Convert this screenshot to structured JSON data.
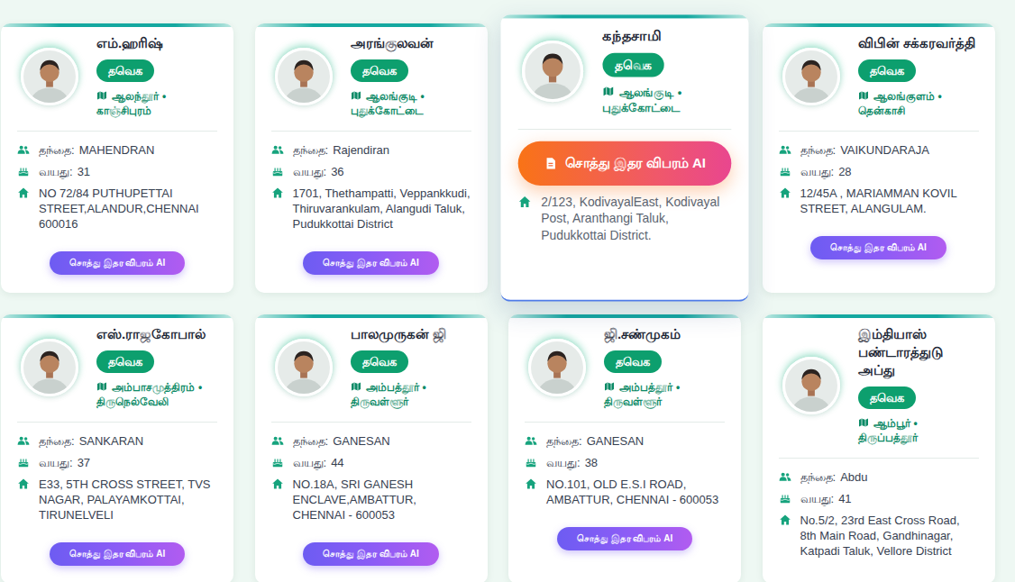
{
  "labels": {
    "father": "தந்தை:",
    "age": "வயது:"
  },
  "separator": "•",
  "button_label": "சொத்து இதர விபரம் AI",
  "candidates": [
    {
      "name": "எம்.ஹரிஷ்",
      "party": "தவெக",
      "constituency": "ஆலந்தூர்",
      "district": "காஞ்சிபுரம்",
      "father": "MAHENDRAN",
      "age": "31",
      "address": "NO 72/84 PUTHUPETTAI STREET,ALANDUR,CHENNAI 600016",
      "hovered": false,
      "button_visible": true
    },
    {
      "name": "அரங்குலவன்",
      "party": "தவெக",
      "constituency": "ஆலங்குடி",
      "district": "புதுக்கோட்டை",
      "father": "Rajendiran",
      "age": "36",
      "address": "1701, Thethampatti, Veppankkudi, Thiruvarankulam, Alangudi Taluk, Pudukkottai District",
      "hovered": false,
      "button_visible": true
    },
    {
      "name": "கந்தசாமி",
      "party": "தவெக",
      "constituency": "ஆலங்குடி",
      "district": "புதுக்கோட்டை",
      "father": null,
      "age": null,
      "address": "2/123, KodivayalEast, Kodivayal Post, Aranthangi Taluk, Pudukkottai District.",
      "hovered": true,
      "button_visible": false
    },
    {
      "name": "விபின் சக்கரவர்த்தி",
      "party": "தவெக",
      "constituency": "ஆலங்குளம்",
      "district": "தென்காசி",
      "father": "VAIKUNDARAJA",
      "age": "28",
      "address": "12/45A , MARIAMMAN KOVIL STREET, ALANGULAM.",
      "hovered": false,
      "button_visible": true
    },
    {
      "name": "எஸ்.ராஜகோபால்",
      "party": "தவெக",
      "constituency": "அம்பாசமுத்திரம்",
      "district": "திருநெல்வேலி",
      "father": "SANKARAN",
      "age": "37",
      "address": "E33, 5TH CROSS STREET, TVS NAGAR, PALAYAMKOTTAI, TIRUNELVELI",
      "hovered": false,
      "button_visible": true
    },
    {
      "name": "பாலமுருகன் ஜி",
      "party": "தவெக",
      "constituency": "அம்பத்தூர்",
      "district": "திருவள்ளூர்",
      "father": "GANESAN",
      "age": "44",
      "address": "NO.18A, SRI GANESH ENCLAVE,AMBATTUR, CHENNAI - 600053",
      "hovered": false,
      "button_visible": true
    },
    {
      "name": "ஜி.சண்முகம்",
      "party": "தவெக",
      "constituency": "அம்பத்தூர்",
      "district": "திருவள்ளூர்",
      "father": "GANESAN",
      "age": "38",
      "address": "NO.101, OLD E.S.I ROAD, AMBATTUR, CHENNAI - 600053",
      "hovered": false,
      "button_visible": true
    },
    {
      "name": "இம்தியாஸ் பண்டாரத்துடு அப்து",
      "party": "தவெக",
      "constituency": "ஆம்பூர்",
      "district": "திருப்பத்தூர்",
      "father": "Abdu",
      "age": "41",
      "address": "No.5/2, 23rd East Cross Road, 8th Main Road, Gandhinagar, Katpadi Taluk, Vellore District",
      "hovered": false,
      "button_visible": false
    }
  ]
}
